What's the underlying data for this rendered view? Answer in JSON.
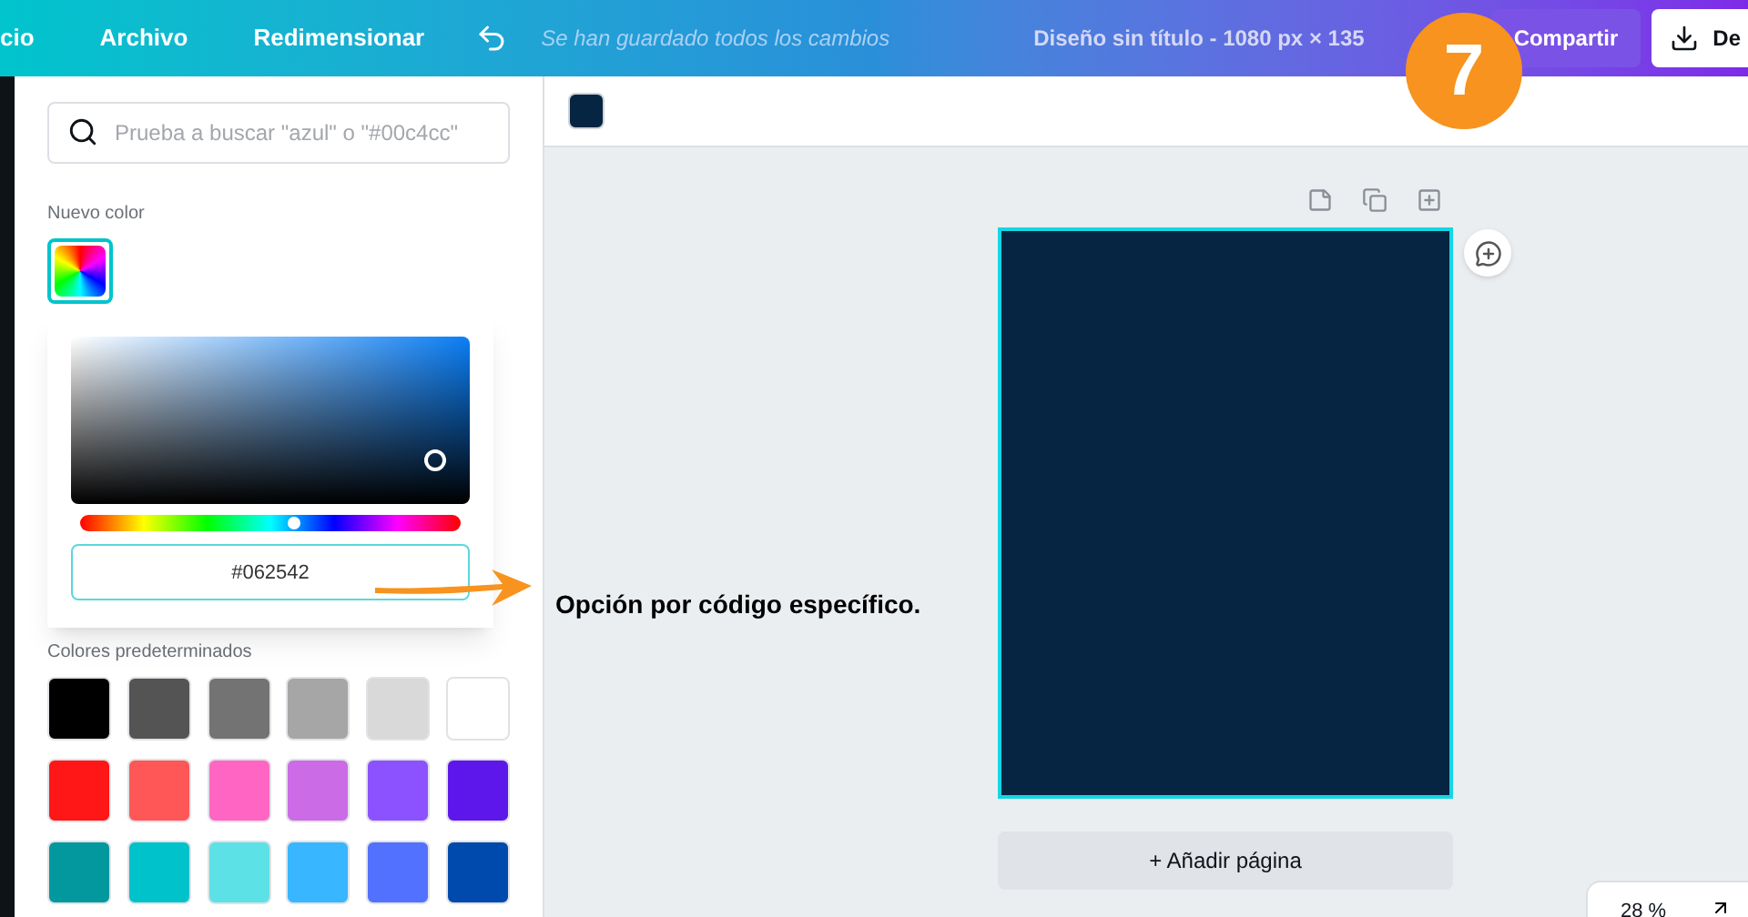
{
  "topbar": {
    "menu": [
      {
        "label": "cio"
      },
      {
        "label": "Archivo"
      },
      {
        "label": "Redimensionar"
      }
    ],
    "save_status": "Se han guardado todos los cambios",
    "design_title": "Diseño sin título - 1080 px × 135",
    "share_button": "Compartir",
    "download_button": "De"
  },
  "color_panel": {
    "search": {
      "placeholder": "Prueba a buscar \"azul\" o \"#00c4cc\""
    },
    "new_color_heading": "Nuevo color",
    "picker": {
      "hue": {
        "level": 0.56
      },
      "hex_value": "#062542"
    },
    "preset_heading": "Colores predeterminados",
    "presets": [
      {
        "color": "#000000"
      },
      {
        "color": "#545454"
      },
      {
        "color": "#737373"
      },
      {
        "color": "#a6a6a6"
      },
      {
        "color": "#d9d9d9"
      },
      {
        "color": "#ffffff"
      },
      {
        "color": "#ff1616"
      },
      {
        "color": "#ff5757"
      },
      {
        "color": "#ff66c4"
      },
      {
        "color": "#cb6ce6"
      },
      {
        "color": "#8c52ff"
      },
      {
        "color": "#5e17eb"
      },
      {
        "color": "#03989e"
      },
      {
        "color": "#00c2cb"
      },
      {
        "color": "#5ce1e6"
      },
      {
        "color": "#38b6ff"
      },
      {
        "color": "#5271ff"
      },
      {
        "color": "#004aad"
      }
    ]
  },
  "canvas": {
    "add_page_button": "+ Añadir página",
    "zoom": "28 %"
  },
  "annotation": {
    "step": "7",
    "text": "Opción por código específico."
  }
}
